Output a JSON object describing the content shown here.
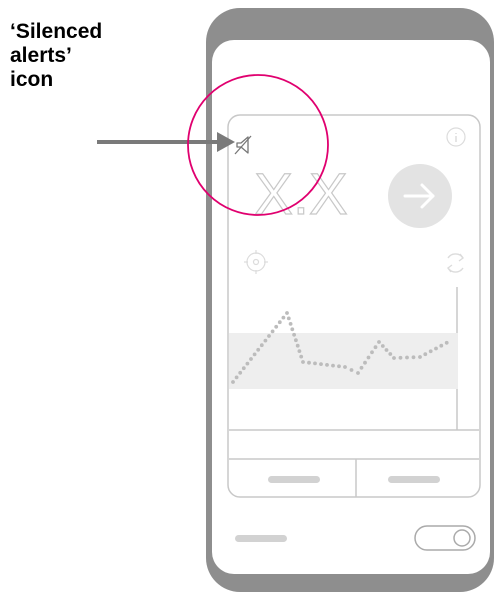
{
  "annotation": {
    "lines": [
      "‘Silenced",
      "alerts’",
      "icon"
    ]
  },
  "phone": {
    "reading_placeholder": "X.X",
    "icons": {
      "silenced": "speaker-muted-icon",
      "info": "info-icon",
      "target": "crosshair-icon",
      "sync": "sync-icon",
      "next": "arrow-right-icon"
    }
  },
  "colors": {
    "highlight": "#e0006f",
    "arrow": "#7a7a7a",
    "frame": "#8e8e8e",
    "screen_line": "#c8c8c8",
    "band": "#eeeeee",
    "dots": "#bcbcbc"
  }
}
